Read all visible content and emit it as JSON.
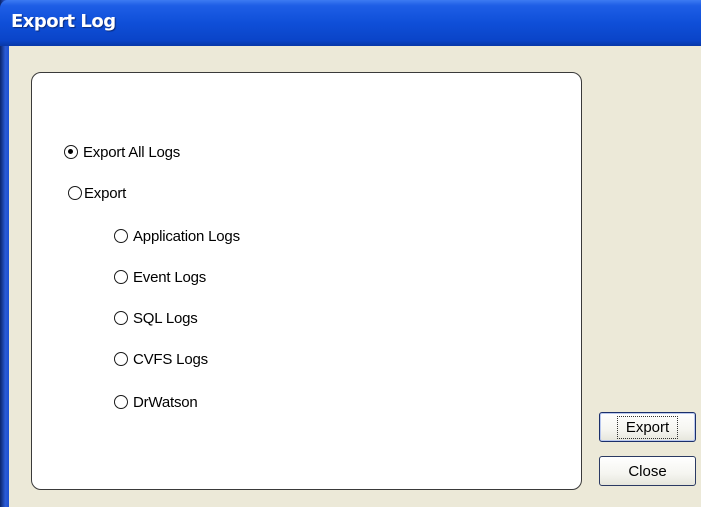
{
  "window": {
    "title": "Export Log"
  },
  "options": [
    {
      "label": "Export All Logs",
      "checked": true
    },
    {
      "label": "Export",
      "checked": false
    },
    {
      "label": "Application Logs",
      "checked": false
    },
    {
      "label": "Event Logs",
      "checked": false
    },
    {
      "label": "SQL Logs",
      "checked": false
    },
    {
      "label": "CVFS Logs",
      "checked": false
    },
    {
      "label": "DrWatson",
      "checked": false
    }
  ],
  "buttons": {
    "export_label": "Export",
    "close_label": "Close"
  },
  "colors": {
    "titlebar": "#0f4fd8",
    "dialog_bg": "#ece9d8",
    "title_text": "#ffffff"
  }
}
